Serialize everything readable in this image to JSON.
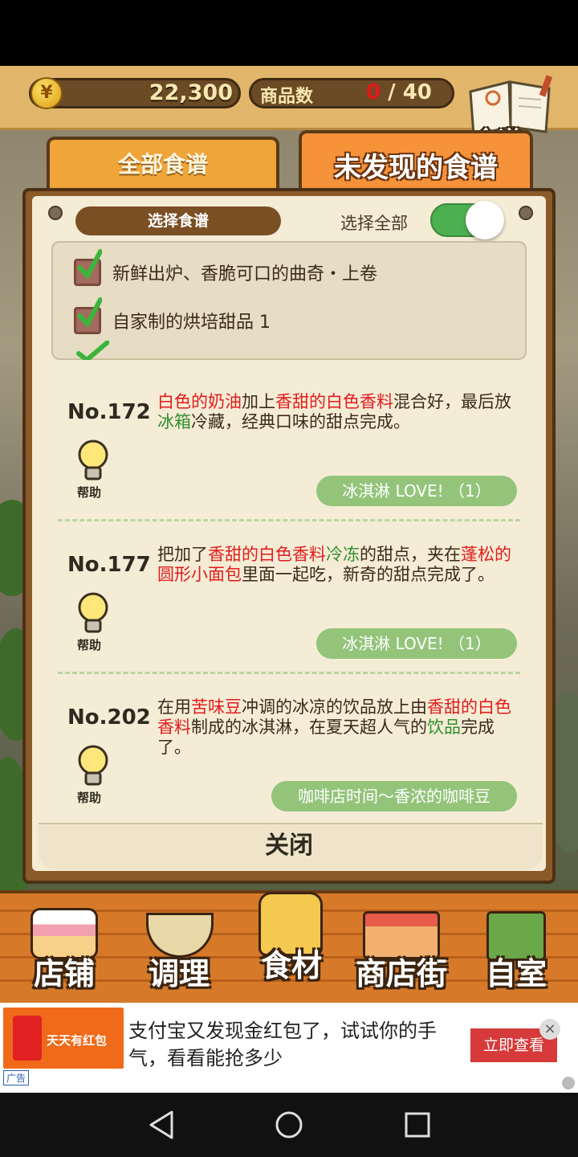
{
  "header": {
    "coin_symbol": "¥",
    "money": "22,300",
    "items_label": "商品数",
    "items_current": "0",
    "items_total": "/ 40",
    "recipe_book_label": "食谱"
  },
  "tabs": [
    {
      "label": "全部食谱",
      "active": false
    },
    {
      "label": "未发现的食谱",
      "active": true
    }
  ],
  "panel": {
    "select_recipe_label": "选择食谱",
    "select_all_label": "选择全部",
    "select_all_on": true,
    "filters": [
      {
        "label": "新鲜出炉、香脆可口的曲奇・上卷",
        "checked": true
      },
      {
        "label": "自家制的烘培甜品 1",
        "checked": true
      }
    ],
    "entries": [
      {
        "number": "No.172",
        "help": "帮助",
        "desc": [
          {
            "t": "白色的奶油",
            "c": "r"
          },
          {
            "t": "加上",
            "c": ""
          },
          {
            "t": "香甜的白色香料",
            "c": "r"
          },
          {
            "t": "混合好，最后放",
            "c": ""
          },
          {
            "t": "冰箱",
            "c": "g"
          },
          {
            "t": "冷藏，经典口味的甜点完成。",
            "c": ""
          }
        ],
        "tag": "冰淇淋 LOVE! （1）"
      },
      {
        "number": "No.177",
        "help": "帮助",
        "desc": [
          {
            "t": "把加了",
            "c": ""
          },
          {
            "t": "香甜的白色香料",
            "c": "r"
          },
          {
            "t": "冷冻",
            "c": "g"
          },
          {
            "t": "的甜点，夹在",
            "c": ""
          },
          {
            "t": "蓬松的圆形小面包",
            "c": "r"
          },
          {
            "t": "里面一起吃，新奇的甜点完成了。",
            "c": ""
          }
        ],
        "tag": "冰淇淋 LOVE! （1）"
      },
      {
        "number": "No.202",
        "help": "帮助",
        "desc": [
          {
            "t": "在用",
            "c": ""
          },
          {
            "t": "苦味豆",
            "c": "r"
          },
          {
            "t": "冲调的冰凉的饮品放上由",
            "c": ""
          },
          {
            "t": "香甜的白色香料",
            "c": "r"
          },
          {
            "t": "制成的冰淇淋，在夏天超人气的",
            "c": ""
          },
          {
            "t": "饮品",
            "c": "g"
          },
          {
            "t": "完成了。",
            "c": ""
          }
        ],
        "tag": "咖啡店时间〜香浓的咖啡豆"
      }
    ],
    "close_label": "关闭"
  },
  "bottom_nav": [
    {
      "label": "店铺",
      "icon": "cake-icon"
    },
    {
      "label": "调理",
      "icon": "mixing-bowl-icon"
    },
    {
      "label": "食材",
      "icon": "flour-sack-icon"
    },
    {
      "label": "商店街",
      "icon": "shop-street-icon"
    },
    {
      "label": "自室",
      "icon": "staff-only-door-icon"
    }
  ],
  "ad": {
    "brand": "天天有红包",
    "text": "支付宝又发现金红包了，试试你的手气，看看能抢多少",
    "cta": "立即查看",
    "tag": "广告",
    "close": "×"
  },
  "colors": {
    "highlight_red": "#e21c1c",
    "highlight_green": "#2f8f2f",
    "toggle_on": "#4caf50",
    "tag_green": "#93c47a"
  }
}
